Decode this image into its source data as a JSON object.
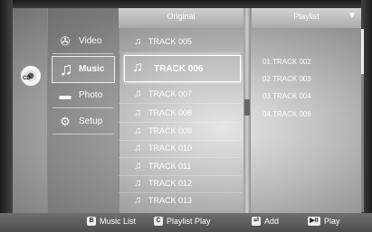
{
  "disc": {
    "label": "CD"
  },
  "menu": {
    "items": [
      {
        "label": "Video",
        "icon": "film-reel-icon"
      },
      {
        "label": "Music",
        "icon": "music-note-icon"
      },
      {
        "label": "Photo",
        "icon": "photo-icon"
      },
      {
        "label": "Setup",
        "icon": "gear-icon"
      }
    ],
    "selected": "Music"
  },
  "original": {
    "title": "Original",
    "tracks": [
      "TRACK 005",
      "TRACK 006",
      "TRACK 007",
      "TRACK 008",
      "TRACK 009",
      "TRACK 010",
      "TRACK 011",
      "TRACK 012",
      "TRACK 013"
    ],
    "selected": "TRACK 006"
  },
  "playlist": {
    "title": "Playlist",
    "items": [
      "01.TRACK 002",
      "02.TRACK 003",
      "03.TRACK 004",
      "04.TRACK 006"
    ]
  },
  "footer": {
    "keys": [
      {
        "key": "B",
        "label": "Music List",
        "color": "#f2f2f2"
      },
      {
        "key": "C",
        "label": "Playlist Play",
        "color": "#f2f2f2"
      },
      {
        "key": "⏎",
        "label": "Add",
        "color": "#f2f2f2"
      },
      {
        "key": "▶II",
        "label": "Play",
        "color": "#f2f2f2"
      }
    ]
  }
}
